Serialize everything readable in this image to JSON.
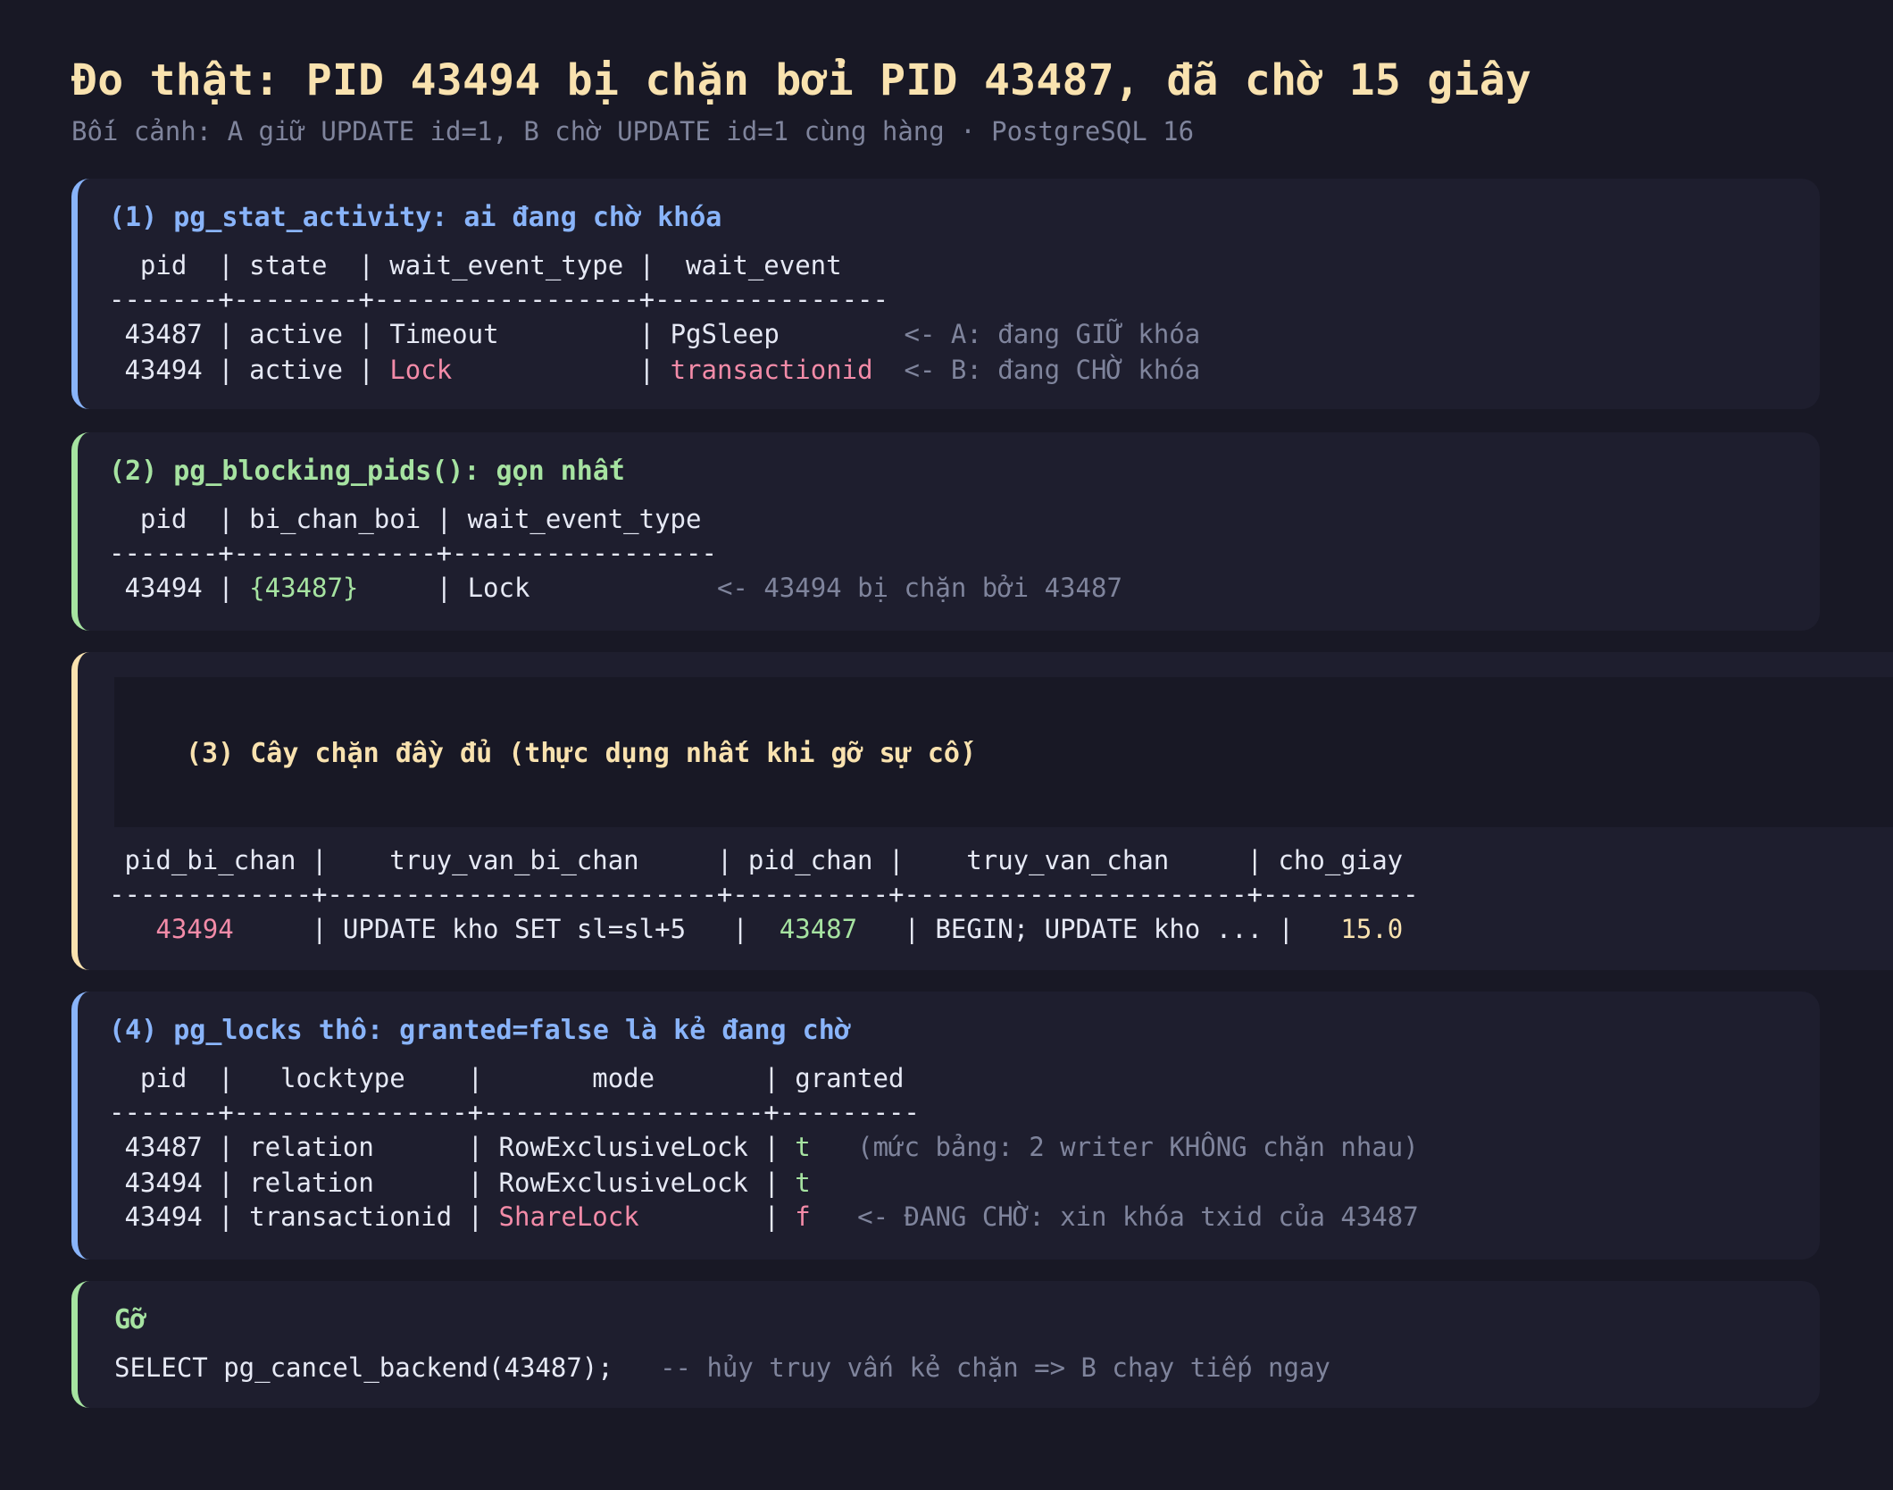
{
  "header": {
    "title": "Đo thật: PID 43494 bị chặn bởi PID 43487, đã chờ 15 giây",
    "subtitle": "Bối cảnh: A giữ UPDATE id=1, B chờ UPDATE id=1 cùng hàng · PostgreSQL 16"
  },
  "card1": {
    "title": "(1) pg_stat_activity: ai đang chờ khóa",
    "header_row": "  pid  | state  | wait_event_type |  wait_event",
    "separator": "-------+--------+-----------------+---------------",
    "rows": [
      {
        "pid": " 43487",
        "state": "active",
        "wait_event_type": "Timeout",
        "wait_event": "PgSleep",
        "note": "<- A: đang GIỮ khóa"
      },
      {
        "pid": " 43494",
        "state": "active",
        "wait_event_type": "Lock",
        "wait_event": "transactionid",
        "note": "<- B: đang CHỜ khóa"
      }
    ]
  },
  "card2": {
    "title": "(2) pg_blocking_pids(): gọn nhất",
    "header_row": "  pid  | bi_chan_boi | wait_event_type",
    "separator": "-------+-------------+-----------------",
    "row": {
      "pid": " 43494",
      "bi_chan_boi": "{43487}",
      "wait_event_type": "Lock",
      "note": "<- 43494 bị chặn bởi 43487"
    }
  },
  "card3": {
    "title": "(3) Cây chặn đầy đủ (thực dụng nhất khi gỡ sự cố)",
    "header_row": " pid_bi_chan |    truy_van_bi_chan     | pid_chan |    truy_van_chan     | cho_giay",
    "separator": "-------------+-------------------------+----------+----------------------+----------",
    "row": {
      "pid_bi_chan": "43494",
      "truy_van_bi_chan": "UPDATE kho SET sl=sl+5",
      "pid_chan": "43487",
      "truy_van_chan": "BEGIN; UPDATE kho ...",
      "cho_giay": "15.0"
    }
  },
  "card4": {
    "title": "(4) pg_locks thô: granted=false là kẻ đang chờ",
    "header_row": "  pid  |   locktype    |       mode       | granted",
    "separator": "-------+---------------+------------------+---------",
    "rows": [
      {
        "pid": " 43487",
        "locktype": "relation",
        "mode": "RowExclusiveLock",
        "granted": "t",
        "note": "(mức bảng: 2 writer KHÔNG chặn nhau)"
      },
      {
        "pid": " 43494",
        "locktype": "relation",
        "mode": "RowExclusiveLock",
        "granted": "t",
        "note": ""
      },
      {
        "pid": " 43494",
        "locktype": "transactionid",
        "mode": "ShareLock",
        "granted": "f",
        "note": "<- ĐANG CHỜ: xin khóa txid của 43487"
      }
    ]
  },
  "card5": {
    "title": "Gỡ",
    "command": "SELECT pg_cancel_backend(43487);",
    "comment": "-- hủy truy vấn kẻ chặn => B chạy tiếp ngay"
  },
  "colors": {
    "background": "#181825",
    "card": "#1e1e2e",
    "blue": "#89b4fa",
    "green": "#a6e3a1",
    "yellow": "#f9e2af",
    "pink": "#f38ba8",
    "muted": "#7f849c"
  }
}
